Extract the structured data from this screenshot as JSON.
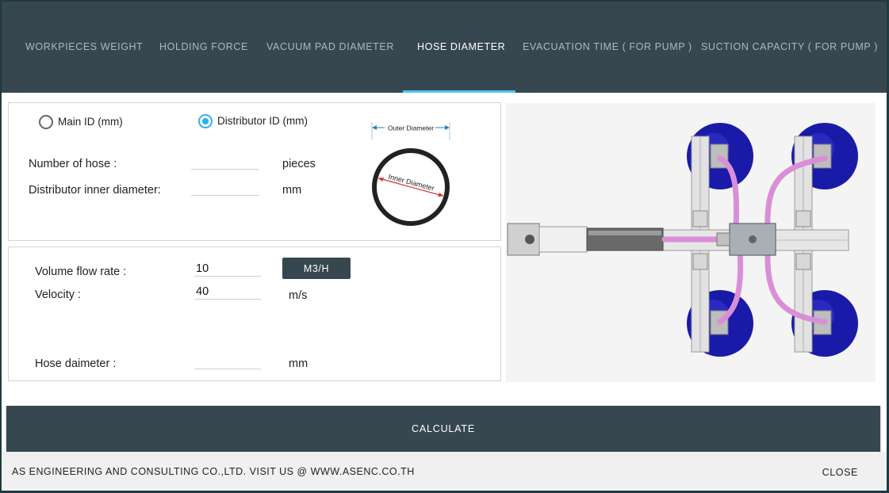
{
  "tabs": [
    {
      "label": "WORKPIECES WEIGHT",
      "active": false
    },
    {
      "label": "HOLDING FORCE",
      "active": false
    },
    {
      "label": "VACUUM PAD DIAMETER",
      "active": false
    },
    {
      "label": "HOSE DIAMETER",
      "active": true
    },
    {
      "label": "EVACUATION TIME ( FOR PUMP )",
      "active": false
    },
    {
      "label": "SUCTION CAPACITY ( FOR PUMP )",
      "active": false
    }
  ],
  "hose_panel": {
    "radio_main": {
      "label": "Main ID (mm)",
      "checked": false
    },
    "radio_distributor": {
      "label": "Distributor ID (mm)",
      "checked": true
    },
    "number_of_hose": {
      "label": "Number of hose :",
      "value": "",
      "unit": "pieces"
    },
    "distributor_inner_diameter": {
      "label": "Distributor inner diameter:",
      "value": "",
      "unit": "mm"
    },
    "diagram": {
      "outer_label": "Outer Diameter",
      "inner_label": "Inner Diameter"
    }
  },
  "flow_panel": {
    "volume_flow_rate": {
      "label": "Volume flow rate :",
      "value": "10",
      "unit_button": "M3/H"
    },
    "velocity": {
      "label": "Velocity :",
      "value": "40",
      "unit": "m/s"
    },
    "hose_diameter": {
      "label": "Hose daimeter :",
      "value": "",
      "unit": "mm"
    }
  },
  "calculate_label": "CALCULATE",
  "footer": {
    "text": "AS ENGINEERING AND CONSULTING CO.,LTD. VISIT US @ WWW.ASENC.CO.TH",
    "close_label": "CLOSE"
  },
  "colors": {
    "header_bg": "#37474f",
    "accent": "#4fc3f7",
    "radio_checked": "#2ab0ee",
    "hose_pink": "#d98fd6",
    "pad_blue": "#1a1aa8"
  },
  "icons": [
    "radio-unchecked-icon",
    "radio-checked-icon",
    "hose-cross-section-diagram",
    "vacuum-gripper-illustration"
  ]
}
